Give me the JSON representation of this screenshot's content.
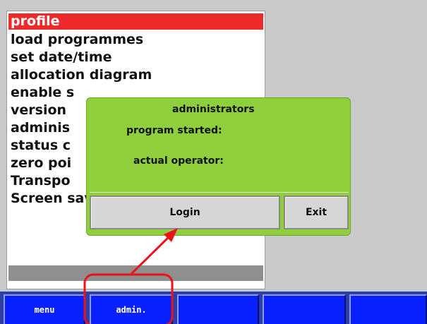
{
  "menu": {
    "items": [
      {
        "label": "profile",
        "selected": true
      },
      {
        "label": "load programmes",
        "selected": false
      },
      {
        "label": "set date/time",
        "selected": false
      },
      {
        "label": "allocation diagram",
        "selected": false
      },
      {
        "label": "enable s",
        "selected": false
      },
      {
        "label": "version",
        "selected": false
      },
      {
        "label": "adminis",
        "selected": false
      },
      {
        "label": "status c",
        "selected": false
      },
      {
        "label": "zero poi",
        "selected": false
      },
      {
        "label": "Transpo",
        "selected": false
      },
      {
        "label": "Screen saver",
        "selected": false
      }
    ]
  },
  "dialog": {
    "title": "administrators",
    "program_started_label": "program started:",
    "actual_operator_label": "actual operator:",
    "login_label": "Login",
    "exit_label": "Exit"
  },
  "function_keys": [
    {
      "label": "menu"
    },
    {
      "label": "admin."
    },
    {
      "label": ""
    },
    {
      "label": ""
    },
    {
      "label": ""
    }
  ],
  "colors": {
    "selected_item": "#ee2b2b",
    "dialog_bg": "#8ecf3b",
    "fkey_bg": "#0a21ff",
    "annotation": "#e8141c"
  }
}
